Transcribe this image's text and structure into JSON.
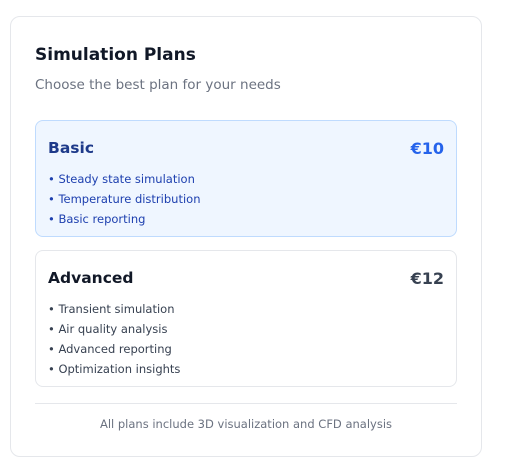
{
  "header": {
    "title": "Simulation Plans",
    "subtitle": "Choose the best plan for your needs"
  },
  "plans": [
    {
      "name": "Basic",
      "price": "€10",
      "selected": true,
      "features": [
        "• Steady state simulation",
        "• Temperature distribution",
        "• Basic reporting"
      ]
    },
    {
      "name": "Advanced",
      "price": "€12",
      "selected": false,
      "features": [
        "• Transient simulation",
        "• Air quality analysis",
        "• Advanced reporting",
        "• Optimization insights"
      ]
    }
  ],
  "footer": {
    "note": "All plans include 3D visualization and CFD analysis"
  },
  "colors": {
    "selected_background": "#eff6ff",
    "selected_border": "#bfdbfe",
    "selected_price": "#2563eb"
  }
}
